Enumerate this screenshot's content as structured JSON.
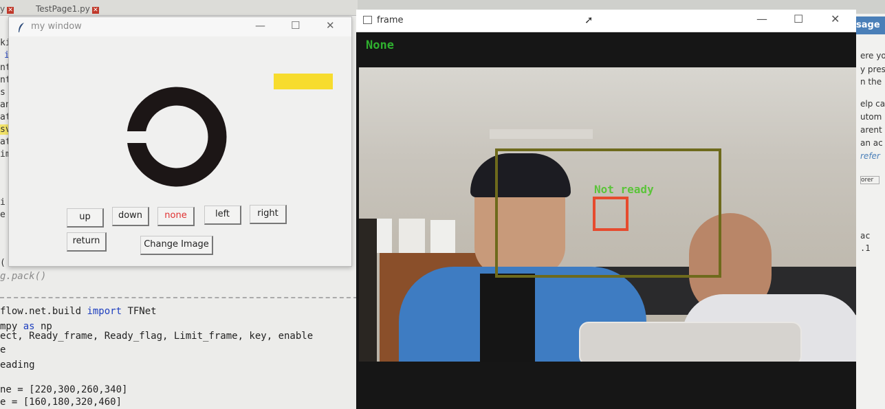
{
  "editor": {
    "tabs": [
      "y",
      "TestPage1.py"
    ],
    "gutter": [
      "ki",
      "i",
      "nt",
      "nt",
      "s",
      "an",
      "at",
      "sv",
      "at",
      "im",
      "i",
      "e",
      "("
    ],
    "pack_line": "g.pack()",
    "code_lines": [
      {
        "text": "flow.net.build ",
        "kw": "import",
        "rest": " TFNet"
      },
      {
        "text": "mpy ",
        "kw": "as",
        "rest": " np"
      },
      {
        "text": "ect, Ready_frame, Ready_flag, Limit_frame, key, enable",
        "kw": "",
        "rest": ""
      },
      {
        "text": "e",
        "kw": "",
        "rest": ""
      },
      {
        "text": "eading",
        "kw": "",
        "rest": ""
      },
      {
        "text": "",
        "kw": "",
        "rest": ""
      },
      {
        "text": "ne = [220,300,260,340]",
        "kw": "",
        "rest": ""
      },
      {
        "text": "e = [160,180,320,460]",
        "kw": "",
        "rest": ""
      }
    ]
  },
  "right_panel": {
    "title": "sage",
    "lines": [
      "ere yo",
      "y pres",
      "n the",
      "",
      "elp ca",
      "utom",
      "arent",
      "an ac",
      "refer",
      "orer",
      "",
      "",
      "",
      "",
      "ac",
      ".1"
    ]
  },
  "my_window": {
    "title": "my window",
    "controls": {
      "minimize": "—",
      "maximize": "☐",
      "close": "✕"
    },
    "indicator_color": "#f7dc2e",
    "buttons": {
      "up": "up",
      "down": "down",
      "none": "none",
      "left": "left",
      "right": "right",
      "return": "return",
      "change_image": "Change Image"
    }
  },
  "frame_window": {
    "title": "frame",
    "controls": {
      "minimize": "—",
      "maximize": "☐",
      "close": "✕"
    },
    "status": "None",
    "detection_label": "Not ready",
    "colors": {
      "status": "#2fb02f",
      "box": "#6e6a1c",
      "target": "#e64b2e",
      "label": "#5bc43a"
    }
  }
}
